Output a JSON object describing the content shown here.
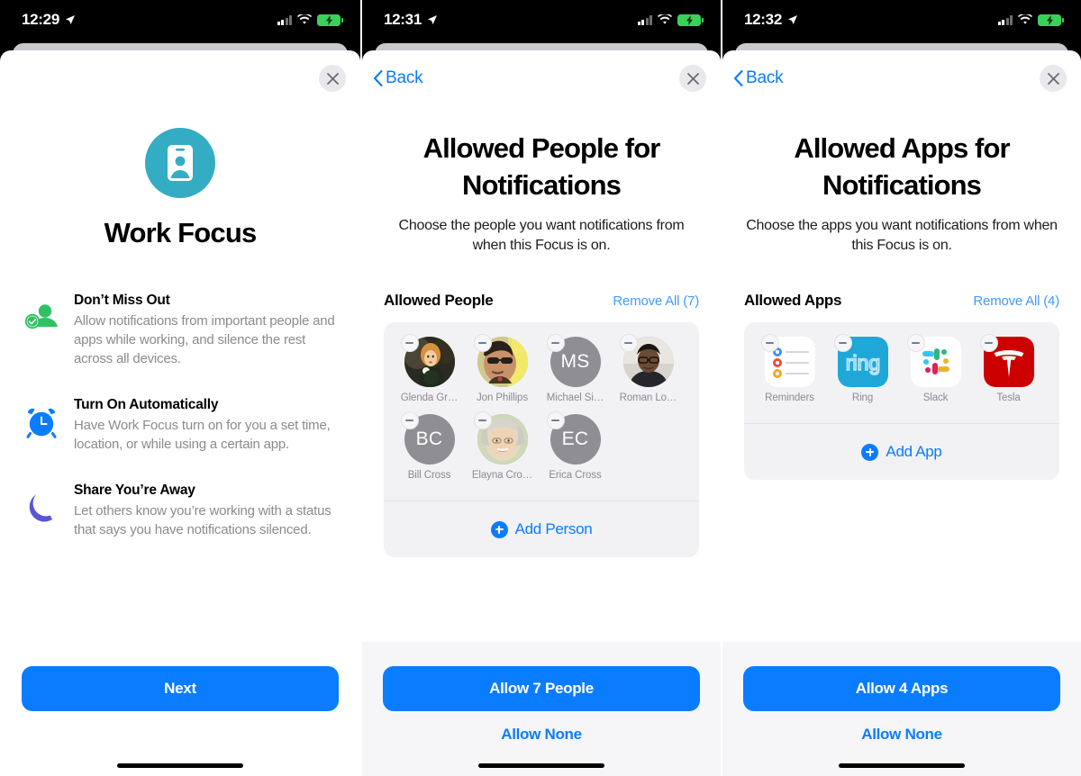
{
  "colors": {
    "accent_blue": "#0a7cff",
    "link_blue": "#3e9bff",
    "focus_teal": "#34acc4",
    "card_gray": "#f2f2f5",
    "bottom_gray": "#f6f6f8",
    "avatar_gray": "#8e8e93",
    "muted_text": "#8b8b90",
    "battery_green": "#3ad15a"
  },
  "screens": [
    {
      "status": {
        "time": "12:29",
        "location_icon": "location-arrow-icon",
        "signal_icon": "cellular-bars-icon",
        "wifi_icon": "wifi-icon",
        "battery_icon": "battery-charging-icon"
      },
      "nav": {
        "back_label": "",
        "has_back": false,
        "close_icon": "close-icon"
      },
      "focus": {
        "icon": "work-badge-icon",
        "title": "Work Focus"
      },
      "features": [
        {
          "icon": "person-check-icon",
          "heading": "Don’t Miss Out",
          "body": "Allow notifications from important people and apps while working, and silence the rest across all devices."
        },
        {
          "icon": "alarm-clock-icon",
          "heading": "Turn On Automatically",
          "body": "Have Work Focus turn on for you a set time, location, or while using a certain app."
        },
        {
          "icon": "crescent-moon-icon",
          "heading": "Share You’re Away",
          "body": "Let others know you’re working with a status that says you have notifications silenced."
        }
      ],
      "bottom": {
        "primary_label": "Next",
        "secondary_label": ""
      }
    },
    {
      "status": {
        "time": "12:31",
        "location_icon": "location-arrow-icon",
        "signal_icon": "cellular-bars-icon",
        "wifi_icon": "wifi-icon",
        "battery_icon": "battery-charging-icon"
      },
      "nav": {
        "back_label": "Back",
        "has_back": true,
        "close_icon": "close-icon"
      },
      "page": {
        "title": "Allowed People for Notifications",
        "subtitle": "Choose the people you want notifications from when this Focus is on."
      },
      "section": {
        "title": "Allowed People",
        "action_label": "Remove All (7)"
      },
      "people": [
        {
          "name": "Glenda Gr…",
          "initials": "",
          "photo": "photo-glenda",
          "remove_icon": "minus-circle-icon"
        },
        {
          "name": "Jon Phillips",
          "initials": "",
          "photo": "photo-jon",
          "remove_icon": "minus-circle-icon"
        },
        {
          "name": "Michael Si…",
          "initials": "MS",
          "photo": "",
          "remove_icon": "minus-circle-icon"
        },
        {
          "name": "Roman Lo…",
          "initials": "",
          "photo": "photo-roman",
          "remove_icon": "minus-circle-icon"
        },
        {
          "name": "Bill Cross",
          "initials": "BC",
          "photo": "",
          "remove_icon": "minus-circle-icon"
        },
        {
          "name": "Elayna Cro…",
          "initials": "",
          "photo": "photo-elayna",
          "remove_icon": "minus-circle-icon"
        },
        {
          "name": "Erica Cross",
          "initials": "EC",
          "photo": "",
          "remove_icon": "minus-circle-icon"
        }
      ],
      "add_row": {
        "icon": "plus-circle-icon",
        "label": "Add Person"
      },
      "bottom": {
        "primary_label": "Allow 7 People",
        "secondary_label": "Allow None"
      }
    },
    {
      "status": {
        "time": "12:32",
        "location_icon": "location-arrow-icon",
        "signal_icon": "cellular-bars-icon",
        "wifi_icon": "wifi-icon",
        "battery_icon": "battery-charging-icon"
      },
      "nav": {
        "back_label": "Back",
        "has_back": true,
        "close_icon": "close-icon"
      },
      "page": {
        "title": "Allowed Apps for Notifications",
        "subtitle": "Choose the apps you want notifications from when this Focus is on."
      },
      "section": {
        "title": "Allowed Apps",
        "action_label": "Remove All (4)"
      },
      "apps": [
        {
          "name": "Reminders",
          "icon": "reminders-app-icon",
          "remove_icon": "minus-circle-icon"
        },
        {
          "name": "Ring",
          "icon": "ring-app-icon",
          "remove_icon": "minus-circle-icon"
        },
        {
          "name": "Slack",
          "icon": "slack-app-icon",
          "remove_icon": "minus-circle-icon"
        },
        {
          "name": "Tesla",
          "icon": "tesla-app-icon",
          "remove_icon": "minus-circle-icon"
        }
      ],
      "add_row": {
        "icon": "plus-circle-icon",
        "label": "Add App"
      },
      "bottom": {
        "primary_label": "Allow 4 Apps",
        "secondary_label": "Allow None"
      }
    }
  ]
}
